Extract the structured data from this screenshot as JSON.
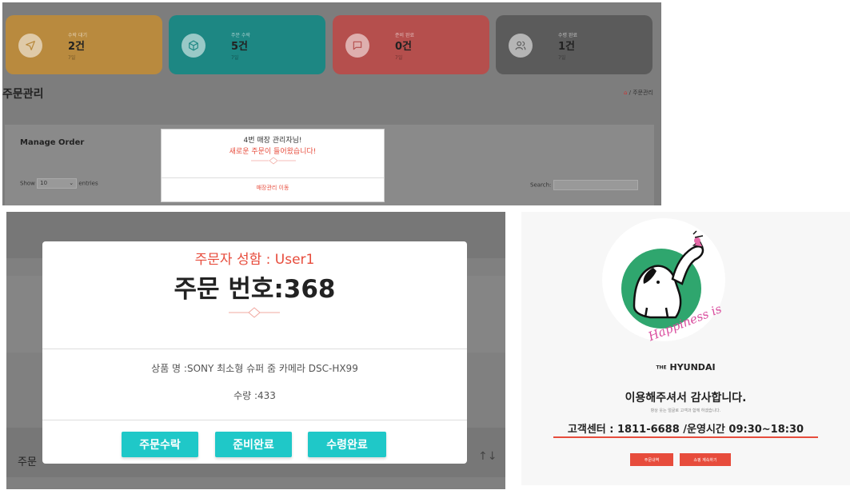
{
  "dashboard": {
    "cards": [
      {
        "label": "수락 대기",
        "count": "2건",
        "sub": "7일",
        "color": "#f2a93b",
        "icon": "send-icon"
      },
      {
        "label": "주문 수락",
        "count": "5건",
        "sub": "7일",
        "color": "#1fa9a5",
        "icon": "box-icon"
      },
      {
        "label": "준비 완료",
        "count": "0건",
        "sub": "7일",
        "color": "#e35d5b",
        "icon": "chat-icon"
      },
      {
        "label": "수령 완료",
        "count": "1건",
        "sub": "7일",
        "color": "#6c6c6c",
        "icon": "users-icon"
      }
    ],
    "page_title": "주문관리",
    "breadcrumb_home": "⌂",
    "breadcrumb_sep": " / ",
    "breadcrumb_current": "주문관리",
    "table_title": "Manage Order",
    "show_label": "Show",
    "show_value": "10",
    "entries_label": "entries",
    "search_label": "Search:"
  },
  "notification": {
    "line1": "4번 매장 관리자님!",
    "line2": "새로운 주문이 들어왔습니다!",
    "link": "매장관리 이동"
  },
  "order_modal": {
    "customer": "주문자 성함 : User1",
    "order_no": "주문 번호:368",
    "product": "상품 명 :SONY 최소형 슈퍼 줌 카메라 DSC-HX99",
    "quantity": "수량 :433",
    "buttons": [
      "주문수락",
      "준비완료",
      "수령완료"
    ],
    "bg_text": "주문",
    "bg_sort": "↑↓",
    "accent": "#1fc8c8"
  },
  "thanks_page": {
    "logo_text": "Happiness is",
    "brand_prefix": "THE",
    "brand": "HYUNDAI",
    "title": "이용해주셔서 감사합니다.",
    "subtitle": "항상 웃는 얼굴로 고객과 함께 하겠습니다.",
    "cs_line": "고객센터 : 1811-6688 /운영시간 09:30~18:30",
    "buttons": [
      "주문내역",
      "쇼핑 계속하기"
    ],
    "accent": "#e74c3c"
  }
}
